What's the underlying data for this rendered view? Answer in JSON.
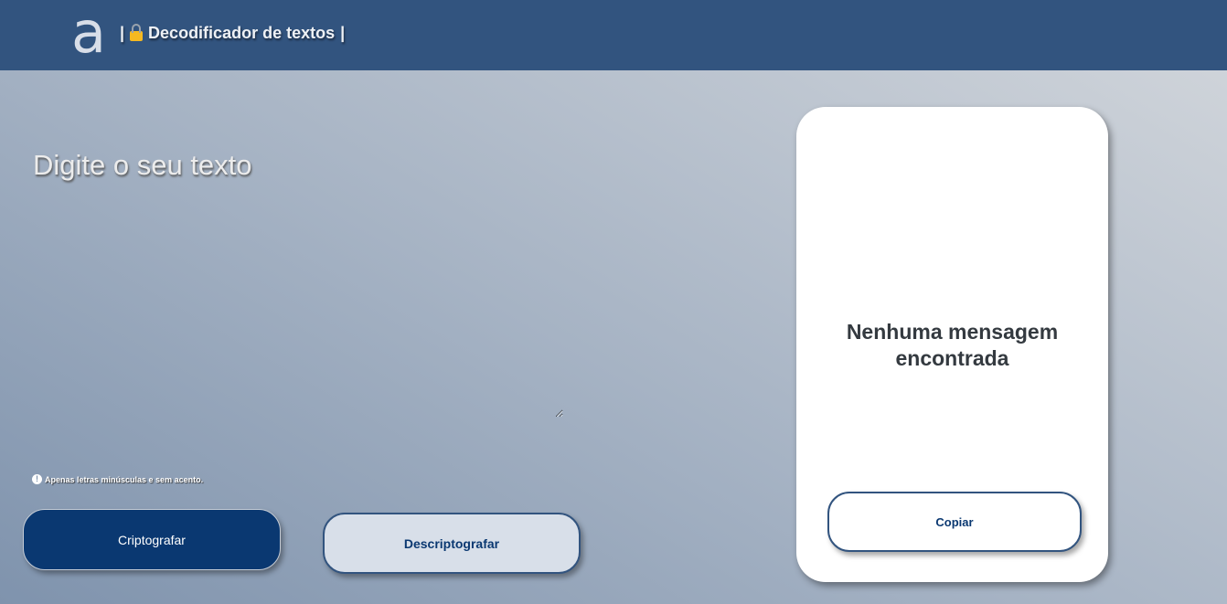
{
  "header": {
    "logo": "a",
    "title_prefix": "|",
    "title": "Decodificador de textos",
    "title_suffix": "|",
    "lock_icon": "lock-icon"
  },
  "main": {
    "heading": "Digite o seu texto",
    "input_value": "",
    "note": "Apenas letras minúsculas e sem acento.",
    "note_icon": "!",
    "encrypt_label": "Criptografar",
    "decrypt_label": "Descriptografar"
  },
  "output": {
    "message": "Nenhuma mensagem encontrada",
    "copy_label": "Copiar"
  }
}
